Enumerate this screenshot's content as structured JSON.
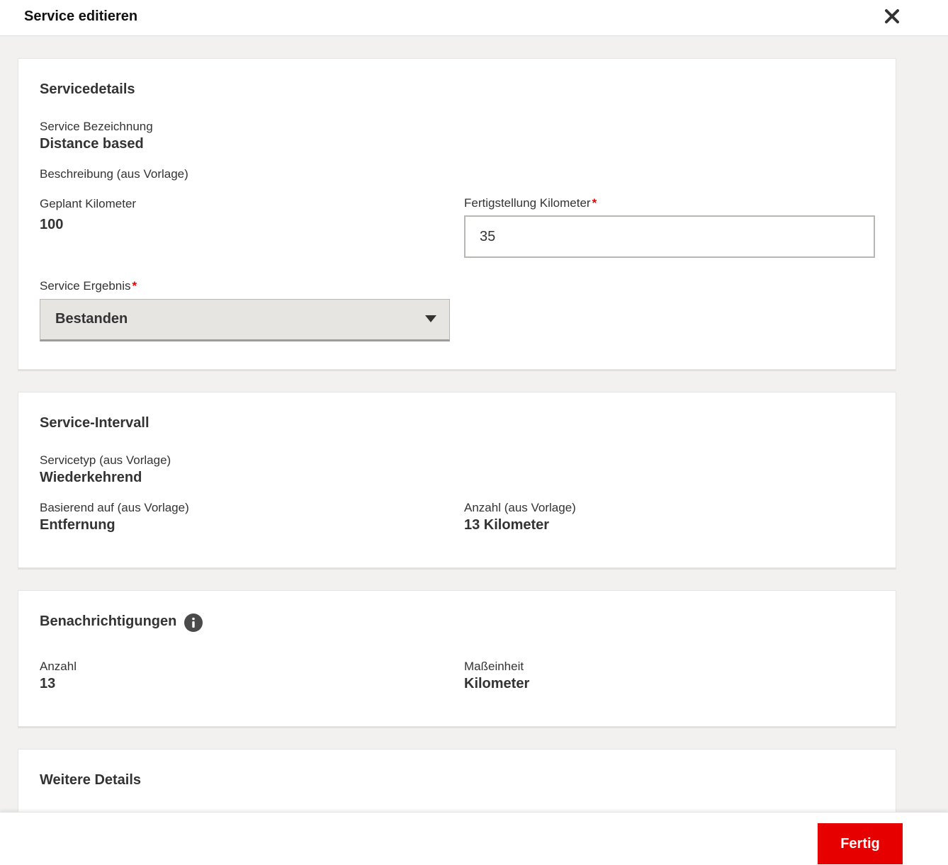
{
  "header": {
    "title": "Service editieren",
    "close_icon": "close-icon"
  },
  "service_details": {
    "title": "Servicedetails",
    "name_label": "Service Bezeichnung",
    "name_value": "Distance based",
    "description_label": "Beschreibung (aus Vorlage)",
    "planned_km_label": "Geplant Kilometer",
    "planned_km_value": "100",
    "completion_km_label": "Fertigstellung Kilometer",
    "completion_km_value": "35",
    "result_label": "Service Ergebnis",
    "result_value": "Bestanden",
    "required_marker": "*"
  },
  "service_interval": {
    "title": "Service-Intervall",
    "type_label": "Servicetyp (aus Vorlage)",
    "type_value": "Wiederkehrend",
    "based_on_label": "Basierend auf (aus Vorlage)",
    "based_on_value": "Entfernung",
    "count_label": "Anzahl (aus Vorlage)",
    "count_value": "13 Kilometer"
  },
  "notifications": {
    "title": "Benachrichtigungen",
    "info_icon": "info-icon",
    "count_label": "Anzahl",
    "count_value": "13",
    "unit_label": "Maßeinheit",
    "unit_value": "Kilometer"
  },
  "more_details": {
    "title": "Weitere Details"
  },
  "footer": {
    "done_label": "Fertig"
  },
  "colors": {
    "accent": "#e60000",
    "background": "#f2f1ef",
    "select_bg": "#e6e5e1"
  }
}
